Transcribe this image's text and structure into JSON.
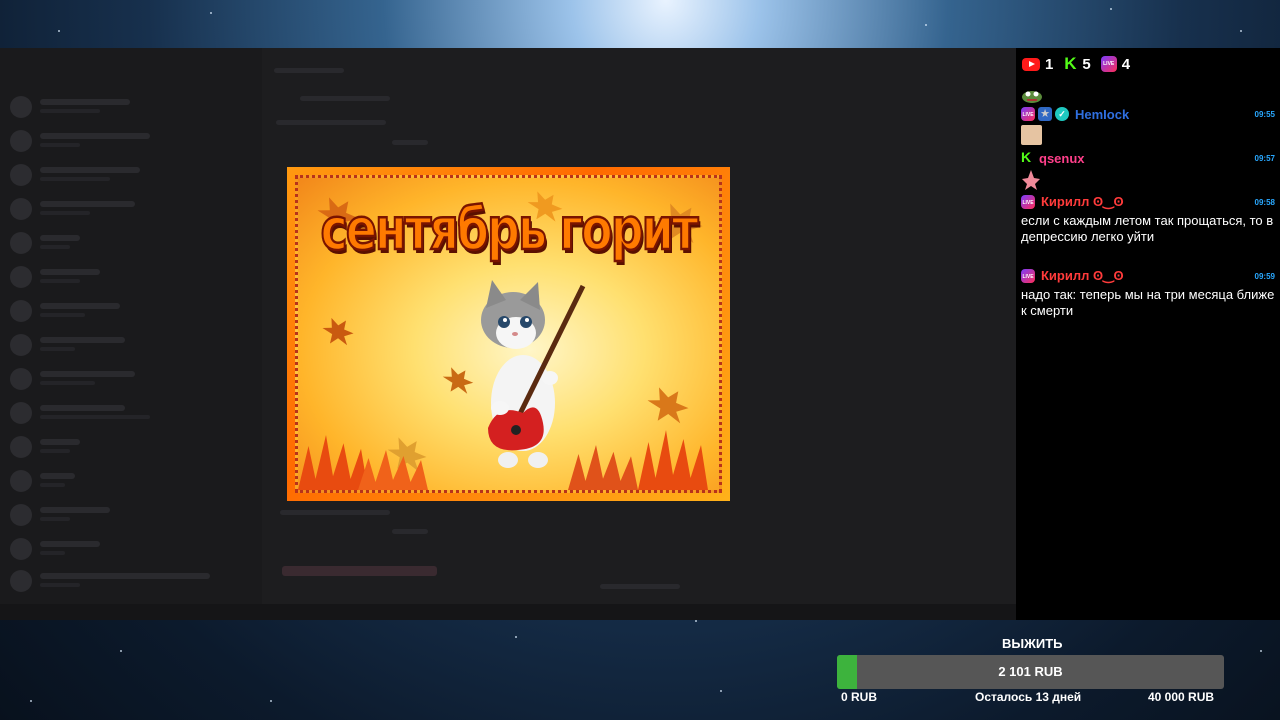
{
  "popup": {
    "title": "сентябрь горит"
  },
  "chat": {
    "counters": [
      {
        "platform": "youtube",
        "icon": "youtube-icon",
        "count": "1"
      },
      {
        "platform": "kick",
        "icon": "kick-icon",
        "count": "5"
      },
      {
        "platform": "vk-live",
        "icon": "live-icon",
        "count": "4"
      }
    ],
    "messages": [
      {
        "name": "HemIock",
        "name_color": "#2f6fe0",
        "time": "09:55",
        "text": ""
      },
      {
        "name": "qsenux",
        "name_color": "#ff3f8a",
        "time": "09:57",
        "text": ""
      },
      {
        "name": "Кирилл ʘ‿ʘ",
        "name_color": "#ff3b3b",
        "time": "09:58",
        "text": "если с каждым летом так прощаться, то в депрессию легко уйти"
      },
      {
        "name": "Кирилл ʘ‿ʘ",
        "name_color": "#ff3b3b",
        "time": "09:59",
        "text": "надо так: теперь мы на три месяца ближе к смерти"
      }
    ]
  },
  "goal": {
    "title": "ВЫЖИТЬ",
    "amount": "2 101 RUB",
    "min": "0 RUB",
    "remaining": "Осталось 13 дней",
    "max": "40 000 RUB",
    "progress": 0.0525,
    "fill_color": "#3db33d"
  }
}
